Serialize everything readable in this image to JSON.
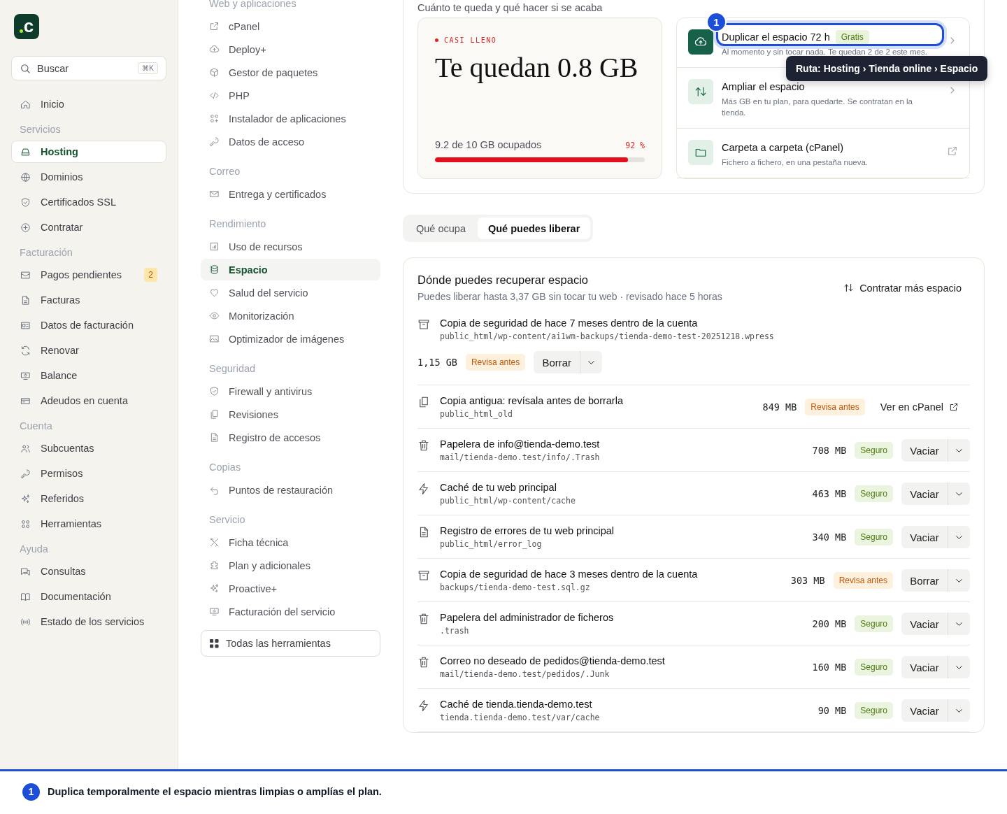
{
  "sidebar": {
    "logo": "c",
    "search": {
      "placeholder": "Buscar",
      "shortcut": "⌘K"
    },
    "items": [
      {
        "kind": "item",
        "label": "Inicio",
        "selected": false
      },
      {
        "kind": "heading",
        "label": "Servicios"
      },
      {
        "kind": "item",
        "label": "Hosting",
        "selected": true
      },
      {
        "kind": "item",
        "label": "Dominios",
        "selected": false
      },
      {
        "kind": "item",
        "label": "Certificados SSL",
        "selected": false
      },
      {
        "kind": "item",
        "label": "Contratar",
        "selected": false
      },
      {
        "kind": "heading",
        "label": "Facturación"
      },
      {
        "kind": "item",
        "label": "Pagos pendientes",
        "selected": false,
        "badge": "2"
      },
      {
        "kind": "item",
        "label": "Facturas",
        "selected": false
      },
      {
        "kind": "item",
        "label": "Datos de facturación",
        "selected": false
      },
      {
        "kind": "item",
        "label": "Renovar",
        "selected": false
      },
      {
        "kind": "item",
        "label": "Balance",
        "selected": false
      },
      {
        "kind": "item",
        "label": "Adeudos en cuenta",
        "selected": false
      },
      {
        "kind": "heading",
        "label": "Cuenta"
      },
      {
        "kind": "item",
        "label": "Subcuentas",
        "selected": false
      },
      {
        "kind": "item",
        "label": "Permisos",
        "selected": false
      },
      {
        "kind": "item",
        "label": "Referidos",
        "selected": false
      },
      {
        "kind": "item",
        "label": "Herramientas",
        "selected": false
      },
      {
        "kind": "heading",
        "label": "Ayuda"
      },
      {
        "kind": "item",
        "label": "Consultas",
        "selected": false
      },
      {
        "kind": "item",
        "label": "Documentación",
        "selected": false
      },
      {
        "kind": "item",
        "label": "Estado de los servicios",
        "selected": false
      }
    ]
  },
  "subnav": {
    "sections": [
      {
        "title": "Web y aplicaciones",
        "items": [
          {
            "label": "cPanel",
            "selected": false
          },
          {
            "label": "Deploy+",
            "selected": false
          },
          {
            "label": "Gestor de paquetes",
            "selected": false
          },
          {
            "label": "PHP",
            "selected": false
          },
          {
            "label": "Instalador de aplicaciones",
            "selected": false
          },
          {
            "label": "Datos de acceso",
            "selected": false
          }
        ]
      },
      {
        "title": "Correo",
        "items": [
          {
            "label": "Entrega y certificados",
            "selected": false
          }
        ]
      },
      {
        "title": "Rendimiento",
        "items": [
          {
            "label": "Uso de recursos",
            "selected": false
          },
          {
            "label": "Espacio",
            "selected": true
          },
          {
            "label": "Salud del servicio",
            "selected": false
          },
          {
            "label": "Monitorización",
            "selected": false
          },
          {
            "label": "Optimizador de imágenes",
            "selected": false
          }
        ]
      },
      {
        "title": "Seguridad",
        "items": [
          {
            "label": "Firewall y antivirus",
            "selected": false
          },
          {
            "label": "Revisiones",
            "selected": false
          },
          {
            "label": "Registro de accesos",
            "selected": false
          }
        ]
      },
      {
        "title": "Copias",
        "items": [
          {
            "label": "Puntos de restauración",
            "selected": false
          }
        ]
      },
      {
        "title": "Servicio",
        "items": [
          {
            "label": "Ficha técnica",
            "selected": false
          },
          {
            "label": "Plan y adicionales",
            "selected": false
          },
          {
            "label": "Proactive+",
            "selected": false
          },
          {
            "label": "Facturación del servicio",
            "selected": false
          }
        ]
      }
    ],
    "all_tools_button": "Todas las herramientas"
  },
  "overview": {
    "heading": "Cuánto te queda y qué hacer si se acaba",
    "usage": {
      "status": "CASI LLENO",
      "remaining": "Te quedan 0.8 GB",
      "used": "9.2 de 10 GB ocupados",
      "percent": "92 %",
      "level": 0.92
    },
    "actions": [
      {
        "kind": "chevron",
        "title": "Duplicar el espacio 72 h",
        "tag": "Gratis",
        "subtitle": "Al momento y sin tocar nada. Te quedan 2 de 2 este mes.",
        "focused": true,
        "marker": "1"
      },
      {
        "kind": "chevron",
        "title": "Ampliar el espacio",
        "subtitle": "Más GB en tu plan, para quedarte. Se contratan en la tienda.",
        "focused": false
      },
      {
        "kind": "external",
        "title": "Carpeta a carpeta (cPanel)",
        "subtitle": "Fichero a fichero, en una pestaña nueva.",
        "focused": false
      }
    ]
  },
  "tooltip": "Ruta: Hosting › Tienda online › Espacio",
  "tabs": [
    {
      "label": "Qué ocupa",
      "selected": false
    },
    {
      "label": "Qué puedes liberar",
      "selected": true
    }
  ],
  "recover": {
    "title": "Dónde puedes recuperar espacio",
    "subtitle": "Puedes liberar hasta 3,37 GB sin tocar tu web · revisado hace 5 horas",
    "action": "Contratar más espacio",
    "rows": [
      {
        "kind": "stacked",
        "title": "Copia de seguridad de hace 7 meses dentro de la cuenta",
        "path": "public_html/wp-content/ai1wm-backups/tienda-demo-test-20251218.wpress",
        "size": "1,15 GB",
        "badge": {
          "text": "Revisa antes",
          "kind": "review"
        },
        "action": {
          "kind": "split",
          "label": "Borrar"
        }
      },
      {
        "kind": "inline",
        "title": "Copia antigua: revísala antes de borrarla",
        "path": "public_html_old",
        "size": "849 MB",
        "badge": {
          "text": "Revisa antes",
          "kind": "review"
        },
        "action": {
          "kind": "link",
          "label": "Ver en cPanel"
        }
      },
      {
        "kind": "inline",
        "title": "Papelera de info@tienda-demo.test",
        "path": "mail/tienda-demo.test/info/.Trash",
        "size": "708 MB",
        "badge": {
          "text": "Seguro",
          "kind": "safe"
        },
        "action": {
          "kind": "split",
          "label": "Vaciar"
        }
      },
      {
        "kind": "inline",
        "title": "Caché de tu web principal",
        "path": "public_html/wp-content/cache",
        "size": "463 MB",
        "badge": {
          "text": "Seguro",
          "kind": "safe"
        },
        "action": {
          "kind": "split",
          "label": "Vaciar"
        }
      },
      {
        "kind": "inline",
        "title": "Registro de errores de tu web principal",
        "path": "public_html/error_log",
        "size": "340 MB",
        "badge": {
          "text": "Seguro",
          "kind": "safe"
        },
        "action": {
          "kind": "split",
          "label": "Vaciar"
        }
      },
      {
        "kind": "inline",
        "title": "Copia de seguridad de hace 3 meses dentro de la cuenta",
        "path": "backups/tienda-demo-test.sql.gz",
        "size": "303 MB",
        "badge": {
          "text": "Revisa antes",
          "kind": "review"
        },
        "action": {
          "kind": "split",
          "label": "Borrar"
        }
      },
      {
        "kind": "inline",
        "title": "Papelera del administrador de ficheros",
        "path": ".trash",
        "size": "200 MB",
        "badge": {
          "text": "Seguro",
          "kind": "safe"
        },
        "action": {
          "kind": "split",
          "label": "Vaciar"
        }
      },
      {
        "kind": "inline",
        "title": "Correo no deseado de pedidos@tienda-demo.test",
        "path": "mail/tienda-demo.test/pedidos/.Junk",
        "size": "160 MB",
        "badge": {
          "text": "Seguro",
          "kind": "safe"
        },
        "action": {
          "kind": "split",
          "label": "Vaciar"
        }
      },
      {
        "kind": "inline",
        "title": "Caché de tienda.tienda-demo.test",
        "path": "tienda.tienda-demo.test/var/cache",
        "size": "90 MB",
        "badge": {
          "text": "Seguro",
          "kind": "safe"
        },
        "action": {
          "kind": "split",
          "label": "Vaciar"
        }
      }
    ]
  },
  "annotation": {
    "marker": "1",
    "text": "Duplica temporalmente el espacio mientras limpias o amplías el plan."
  }
}
